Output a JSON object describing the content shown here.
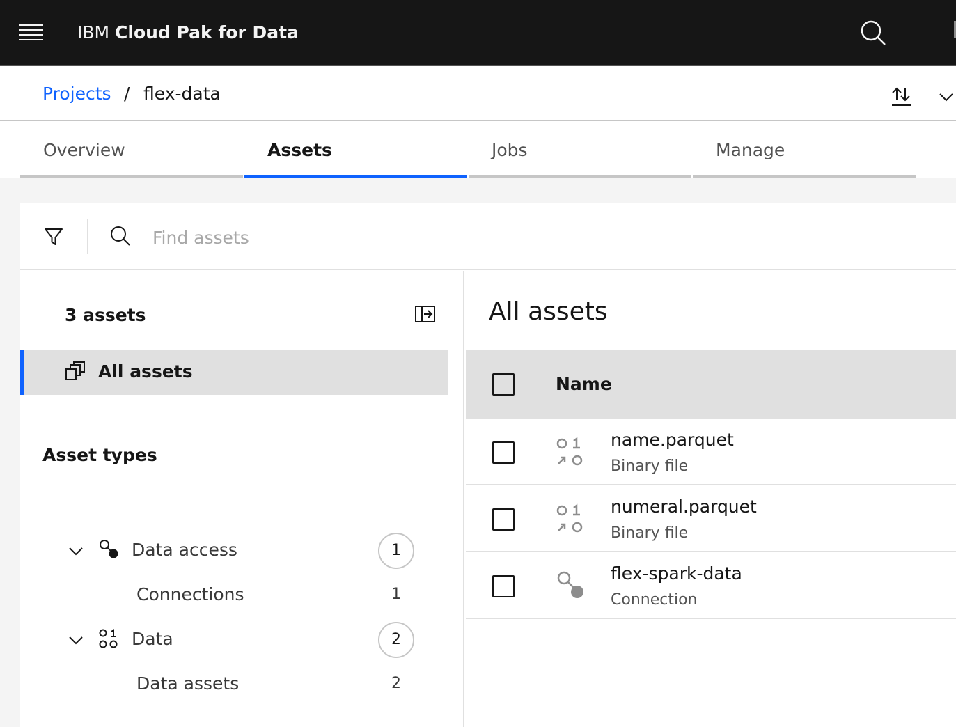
{
  "header": {
    "brand_prefix": "IBM",
    "brand_product": "Cloud Pak for Data"
  },
  "breadcrumb": {
    "parent": "Projects",
    "separator": "/",
    "current": "flex-data"
  },
  "tabs": [
    {
      "label": "Overview",
      "active": false
    },
    {
      "label": "Assets",
      "active": true
    },
    {
      "label": "Jobs",
      "active": false
    },
    {
      "label": "Manage",
      "active": false
    }
  ],
  "search": {
    "placeholder": "Find assets",
    "value": ""
  },
  "sidebar": {
    "count_label": "3 assets",
    "all_assets_label": "All assets",
    "types_title": "Asset types",
    "types": [
      {
        "label": "Data access",
        "count": "1",
        "icon": "connection-icon",
        "children": [
          {
            "label": "Connections",
            "count": "1"
          }
        ]
      },
      {
        "label": "Data",
        "count": "2",
        "icon": "data-icon",
        "children": [
          {
            "label": "Data assets",
            "count": "2"
          }
        ]
      }
    ]
  },
  "main": {
    "title": "All assets",
    "column_name": "Name",
    "rows": [
      {
        "name": "name.parquet",
        "type": "Binary file",
        "icon": "binary-file-icon"
      },
      {
        "name": "numeral.parquet",
        "type": "Binary file",
        "icon": "binary-file-icon"
      },
      {
        "name": "flex-spark-data",
        "type": "Connection",
        "icon": "connection-icon"
      }
    ]
  },
  "colors": {
    "accent": "#0f62fe",
    "topbar": "#161616",
    "selected_bg": "#e0e0e0"
  }
}
